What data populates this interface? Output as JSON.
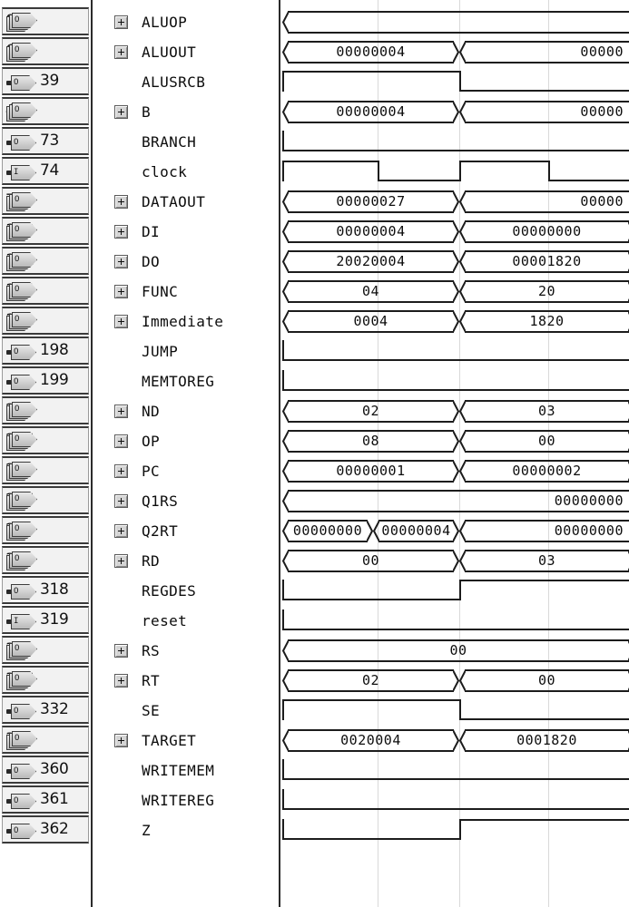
{
  "window": {
    "title": "Waveform Viewer",
    "type": "simulation-waveform"
  },
  "columns": {
    "id_header": "",
    "name_header": "",
    "wave_header": ""
  },
  "colors": {
    "wave_line": "#1c1c1c",
    "grid": "#d9d9d9",
    "cell_bg": "#f2f2f2",
    "panel_bg": "#ffffff",
    "text": "#0d0d0d"
  },
  "grid_x": [
    105,
    195,
    293,
    383
  ],
  "signals": [
    {
      "id": "0",
      "icon": "bus-output-icon",
      "name": "ALUOP",
      "expandable": true,
      "kind": "bus",
      "segments": [
        {
          "text": "",
          "start": 0,
          "end": 388,
          "align": "center",
          "open_right": true
        }
      ]
    },
    {
      "id": "6",
      "icon": "bus-output-icon",
      "name": "ALUOUT",
      "expandable": true,
      "kind": "bus",
      "segments": [
        {
          "text": "00000004",
          "start": 0,
          "end": 195,
          "align": "center"
        },
        {
          "text": "00000",
          "start": 195,
          "end": 388,
          "align": "right",
          "open_right": true
        }
      ]
    },
    {
      "id": "39",
      "icon": "bit-output-icon",
      "name": "ALUSRCB",
      "expandable": false,
      "kind": "bit",
      "levels": [
        {
          "start": 0,
          "end": 195,
          "value": 1
        },
        {
          "start": 195,
          "end": 388,
          "value": 0
        }
      ]
    },
    {
      "id": "40",
      "icon": "bus-output-icon",
      "name": "B",
      "expandable": true,
      "kind": "bus",
      "segments": [
        {
          "text": "00000004",
          "start": 0,
          "end": 195,
          "align": "center"
        },
        {
          "text": "00000",
          "start": 195,
          "end": 388,
          "align": "right",
          "open_right": true
        }
      ]
    },
    {
      "id": "73",
      "icon": "bit-output-icon",
      "name": "BRANCH",
      "expandable": false,
      "kind": "bit",
      "levels": [
        {
          "start": 0,
          "end": 388,
          "value": 0
        }
      ]
    },
    {
      "id": "74",
      "icon": "bit-input-icon",
      "name": "clock",
      "expandable": false,
      "kind": "bit",
      "levels": [
        {
          "start": 0,
          "end": 105,
          "value": 1
        },
        {
          "start": 105,
          "end": 195,
          "value": 0
        },
        {
          "start": 195,
          "end": 293,
          "value": 1
        },
        {
          "start": 293,
          "end": 388,
          "value": 0
        }
      ]
    },
    {
      "id": "75",
      "icon": "bus-output-icon",
      "name": "DATAOUT",
      "expandable": true,
      "kind": "bus",
      "segments": [
        {
          "text": "00000027",
          "start": 0,
          "end": 195,
          "align": "center"
        },
        {
          "text": "00000",
          "start": 195,
          "end": 388,
          "align": "right",
          "open_right": true
        }
      ]
    },
    {
      "id": "108",
      "icon": "bus-output-icon",
      "name": "DI",
      "expandable": true,
      "kind": "bus",
      "segments": [
        {
          "text": "00000004",
          "start": 0,
          "end": 195,
          "align": "center"
        },
        {
          "text": "00000000",
          "start": 195,
          "end": 388,
          "align": "center"
        }
      ]
    },
    {
      "id": "141",
      "icon": "bus-output-icon",
      "name": "DO",
      "expandable": true,
      "kind": "bus",
      "segments": [
        {
          "text": "20020004",
          "start": 0,
          "end": 195,
          "align": "center"
        },
        {
          "text": "00001820",
          "start": 195,
          "end": 388,
          "align": "center"
        }
      ]
    },
    {
      "id": "174",
      "icon": "bus-output-icon",
      "name": "FUNC",
      "expandable": true,
      "kind": "bus",
      "segments": [
        {
          "text": "04",
          "start": 0,
          "end": 195,
          "align": "center"
        },
        {
          "text": "20",
          "start": 195,
          "end": 388,
          "align": "center"
        }
      ]
    },
    {
      "id": "181",
      "icon": "bus-output-icon",
      "name": "Immediate",
      "expandable": true,
      "kind": "bus",
      "segments": [
        {
          "text": "0004",
          "start": 0,
          "end": 195,
          "align": "center"
        },
        {
          "text": "1820",
          "start": 195,
          "end": 388,
          "align": "center"
        }
      ]
    },
    {
      "id": "198",
      "icon": "bit-output-icon",
      "name": "JUMP",
      "expandable": false,
      "kind": "bit",
      "levels": [
        {
          "start": 0,
          "end": 388,
          "value": 0
        }
      ]
    },
    {
      "id": "199",
      "icon": "bit-output-icon",
      "name": "MEMTOREG",
      "expandable": false,
      "kind": "bit",
      "levels": [
        {
          "start": 0,
          "end": 388,
          "value": 0
        }
      ]
    },
    {
      "id": "200",
      "icon": "bus-output-icon",
      "name": "ND",
      "expandable": true,
      "kind": "bus",
      "segments": [
        {
          "text": "02",
          "start": 0,
          "end": 195,
          "align": "center"
        },
        {
          "text": "03",
          "start": 195,
          "end": 388,
          "align": "center"
        }
      ]
    },
    {
      "id": "206",
      "icon": "bus-output-icon",
      "name": "OP",
      "expandable": true,
      "kind": "bus",
      "segments": [
        {
          "text": "08",
          "start": 0,
          "end": 195,
          "align": "center"
        },
        {
          "text": "00",
          "start": 195,
          "end": 388,
          "align": "center"
        }
      ]
    },
    {
      "id": "213",
      "icon": "bus-output-icon",
      "name": "PC",
      "expandable": true,
      "kind": "bus",
      "segments": [
        {
          "text": "00000001",
          "start": 0,
          "end": 195,
          "align": "center"
        },
        {
          "text": "00000002",
          "start": 195,
          "end": 388,
          "align": "center"
        }
      ]
    },
    {
      "id": "246",
      "icon": "bus-output-icon",
      "name": "Q1RS",
      "expandable": true,
      "kind": "bus",
      "segments": [
        {
          "text": "00000000",
          "start": 0,
          "end": 388,
          "align": "right",
          "open_right": true
        }
      ]
    },
    {
      "id": "279",
      "icon": "bus-output-icon",
      "name": "Q2RT",
      "expandable": true,
      "kind": "bus",
      "segments": [
        {
          "text": "00000000",
          "start": 0,
          "end": 100,
          "align": "center"
        },
        {
          "text": "00000004",
          "start": 100,
          "end": 195,
          "align": "center"
        },
        {
          "text": "00000000",
          "start": 195,
          "end": 388,
          "align": "right",
          "open_right": true
        }
      ]
    },
    {
      "id": "312",
      "icon": "bus-output-icon",
      "name": "RD",
      "expandable": true,
      "kind": "bus",
      "segments": [
        {
          "text": "00",
          "start": 0,
          "end": 195,
          "align": "center"
        },
        {
          "text": "03",
          "start": 195,
          "end": 388,
          "align": "center"
        }
      ]
    },
    {
      "id": "318",
      "icon": "bit-output-icon",
      "name": "REGDES",
      "expandable": false,
      "kind": "bit",
      "levels": [
        {
          "start": 0,
          "end": 195,
          "value": 0
        },
        {
          "start": 195,
          "end": 388,
          "value": 1
        }
      ]
    },
    {
      "id": "319",
      "icon": "bit-input-icon",
      "name": "reset",
      "expandable": false,
      "kind": "bit",
      "levels": [
        {
          "start": 0,
          "end": 388,
          "value": 0
        }
      ]
    },
    {
      "id": "320",
      "icon": "bus-output-icon",
      "name": "RS",
      "expandable": true,
      "kind": "bus",
      "segments": [
        {
          "text": "00",
          "start": 0,
          "end": 388,
          "align": "center"
        }
      ]
    },
    {
      "id": "326",
      "icon": "bus-output-icon",
      "name": "RT",
      "expandable": true,
      "kind": "bus",
      "segments": [
        {
          "text": "02",
          "start": 0,
          "end": 195,
          "align": "center"
        },
        {
          "text": "00",
          "start": 195,
          "end": 388,
          "align": "center"
        }
      ]
    },
    {
      "id": "332",
      "icon": "bit-output-icon",
      "name": "SE",
      "expandable": false,
      "kind": "bit",
      "levels": [
        {
          "start": 0,
          "end": 195,
          "value": 1
        },
        {
          "start": 195,
          "end": 388,
          "value": 0
        }
      ]
    },
    {
      "id": "333",
      "icon": "bus-output-icon",
      "name": "TARGET",
      "expandable": true,
      "kind": "bus",
      "segments": [
        {
          "text": "0020004",
          "start": 0,
          "end": 195,
          "align": "center"
        },
        {
          "text": "0001820",
          "start": 195,
          "end": 388,
          "align": "center"
        }
      ]
    },
    {
      "id": "360",
      "icon": "bit-output-icon",
      "name": "WRITEMEM",
      "expandable": false,
      "kind": "bit",
      "levels": [
        {
          "start": 0,
          "end": 388,
          "value": 0
        }
      ]
    },
    {
      "id": "361",
      "icon": "bit-output-icon",
      "name": "WRITEREG",
      "expandable": false,
      "kind": "bit",
      "levels": [
        {
          "start": 0,
          "end": 388,
          "value": 0
        }
      ]
    },
    {
      "id": "362",
      "icon": "bit-output-icon",
      "name": "Z",
      "expandable": false,
      "kind": "bit",
      "levels": [
        {
          "start": 0,
          "end": 195,
          "value": 0
        },
        {
          "start": 195,
          "end": 388,
          "value": 1
        }
      ]
    }
  ]
}
